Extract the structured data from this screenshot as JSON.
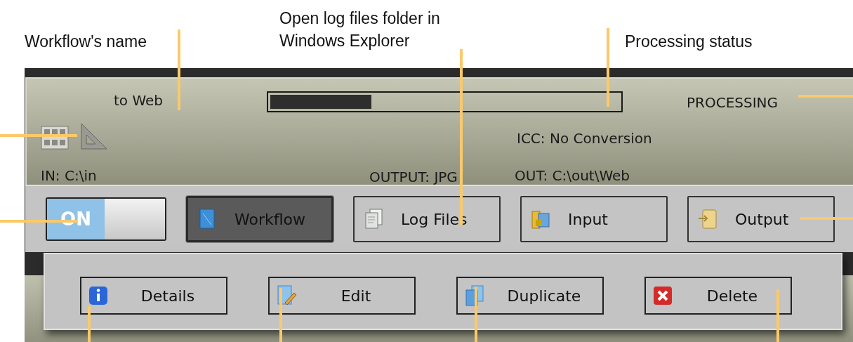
{
  "annotations": [
    {
      "text": "Workflow's name"
    },
    {
      "text": "Open log files folder in\nWindows Explorer"
    },
    {
      "text": "Processing status"
    }
  ],
  "workflow": {
    "name": "to Web",
    "progress": {
      "level": 0.29
    },
    "status": "PROCESSING",
    "icc": "ICC: No Conversion",
    "input": "IN: C:\\in",
    "output_format": "OUTPUT: JPG",
    "output": "OUT: C:\\out\\Web"
  },
  "toggle": {
    "label": "ON",
    "on": true
  },
  "buttons": [
    {
      "kind": "workflow",
      "label": "Workflow",
      "selected": true
    },
    {
      "kind": "logs",
      "label": "Log Files",
      "selected": false
    },
    {
      "kind": "input",
      "label": "Input",
      "selected": false
    },
    {
      "kind": "output",
      "label": "Output",
      "selected": false
    }
  ],
  "menu_buttons": [
    {
      "kind": "details",
      "label": "Details"
    },
    {
      "kind": "edit",
      "label": "Edit"
    },
    {
      "kind": "duplicate",
      "label": "Duplicate"
    },
    {
      "kind": "delete",
      "label": "Delete"
    }
  ]
}
